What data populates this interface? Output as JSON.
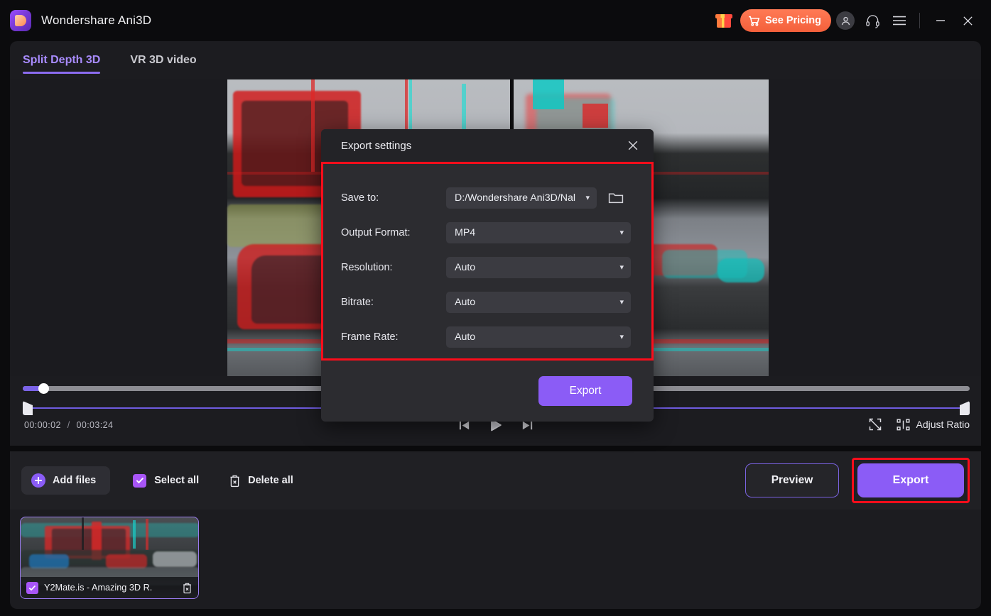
{
  "titlebar": {
    "app_name": "Wondershare Ani3D",
    "logo_icon": "wondershare-logo-icon",
    "gift_icon": "gift-icon",
    "pricing_label": "See Pricing",
    "cart_icon": "shopping-cart-icon",
    "account_icon": "user-account-icon",
    "support_icon": "headset-support-icon",
    "menu_icon": "hamburger-menu-icon",
    "minimize_icon": "minimize-icon",
    "close_icon": "close-icon"
  },
  "tabs": [
    {
      "label": "Split Depth 3D",
      "active": true
    },
    {
      "label": "VR 3D video",
      "active": false
    }
  ],
  "player": {
    "current_time": "00:00:02",
    "separator": "/",
    "total_time": "00:03:24",
    "progress_percent": 2.2,
    "prev_frame_icon": "previous-frame-icon",
    "play_icon": "play-icon",
    "next_frame_icon": "next-frame-icon",
    "fullscreen_icon": "fullscreen-icon",
    "adjust_ratio_icon": "adjust-ratio-icon",
    "adjust_ratio_label": "Adjust Ratio"
  },
  "toolbar": {
    "add_files_label": "Add files",
    "add_files_icon": "plus-circle-icon",
    "select_all_label": "Select all",
    "select_all_checked": true,
    "delete_all_label": "Delete all",
    "delete_all_icon": "trash-icon",
    "preview_label": "Preview",
    "export_label": "Export",
    "export_highlight_color": "#fc0d1b"
  },
  "media_items": [
    {
      "name": "Y2Mate.is - Amazing 3D R.",
      "checked": true,
      "delete_icon": "trash-icon"
    }
  ],
  "dialog": {
    "title": "Export settings",
    "close_icon": "close-icon",
    "highlight_color": "#fc0d1b",
    "folder_icon": "folder-icon",
    "caret_icon": "chevron-down-icon",
    "fields": [
      {
        "label": "Save to:",
        "value": "D:/Wondershare Ani3D/Nal",
        "has_folder_button": true
      },
      {
        "label": "Output Format:",
        "value": "MP4",
        "has_folder_button": false
      },
      {
        "label": "Resolution:",
        "value": "Auto",
        "has_folder_button": false
      },
      {
        "label": "Bitrate:",
        "value": "Auto",
        "has_folder_button": false
      },
      {
        "label": "Frame Rate:",
        "value": "Auto",
        "has_folder_button": false
      }
    ],
    "export_label": "Export"
  },
  "colors": {
    "accent_purple": "#8b5cf6",
    "brand_orange": "#f4603b",
    "highlight_red": "#fc0d1b",
    "panel_bg": "#1c1c20",
    "dialog_bg": "#2c2c30"
  }
}
